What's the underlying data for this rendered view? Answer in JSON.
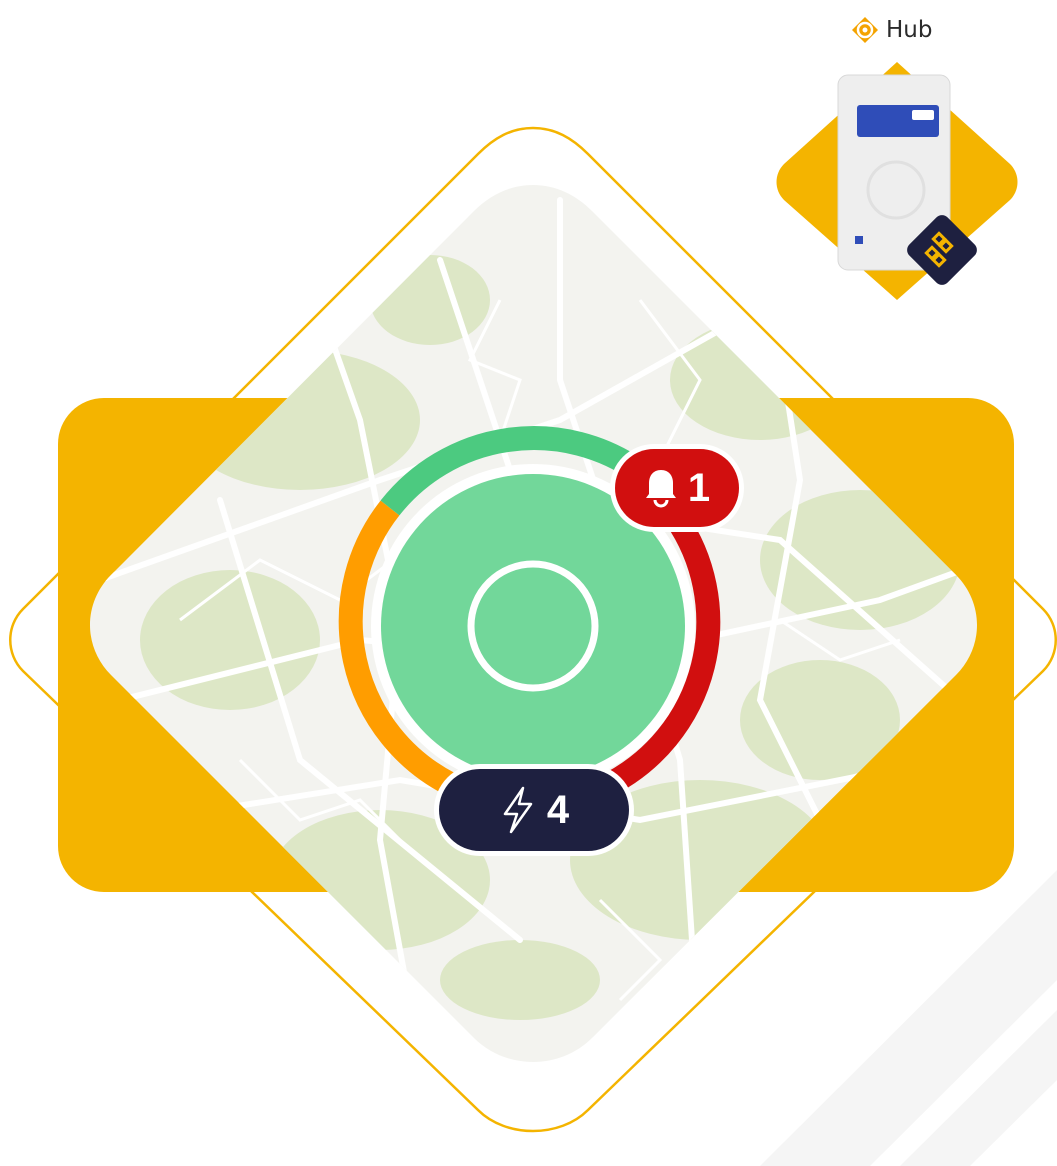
{
  "hub": {
    "label": "Hub",
    "logo_icon": "swirl-logo-icon",
    "device_icon": "hub-device-icon",
    "network_icon": "network-nodes-icon"
  },
  "status_ring": {
    "segments": [
      {
        "status": "ok",
        "color": "#4cca80"
      },
      {
        "status": "alert",
        "color": "#d10f0f"
      },
      {
        "status": "warning",
        "color": "#ff9d00"
      }
    ],
    "center_fill": "#72d79a",
    "center_icon": "ring-marker-icon"
  },
  "alerts": {
    "icon": "bell-icon",
    "count": "1",
    "color": "#d10f0f"
  },
  "energy": {
    "icon": "lightning-icon",
    "count": "4",
    "color": "#1e2040"
  },
  "colors": {
    "accent": "#f4b400",
    "map_background": "#f3f3ef",
    "map_green": "#dde7c6"
  }
}
